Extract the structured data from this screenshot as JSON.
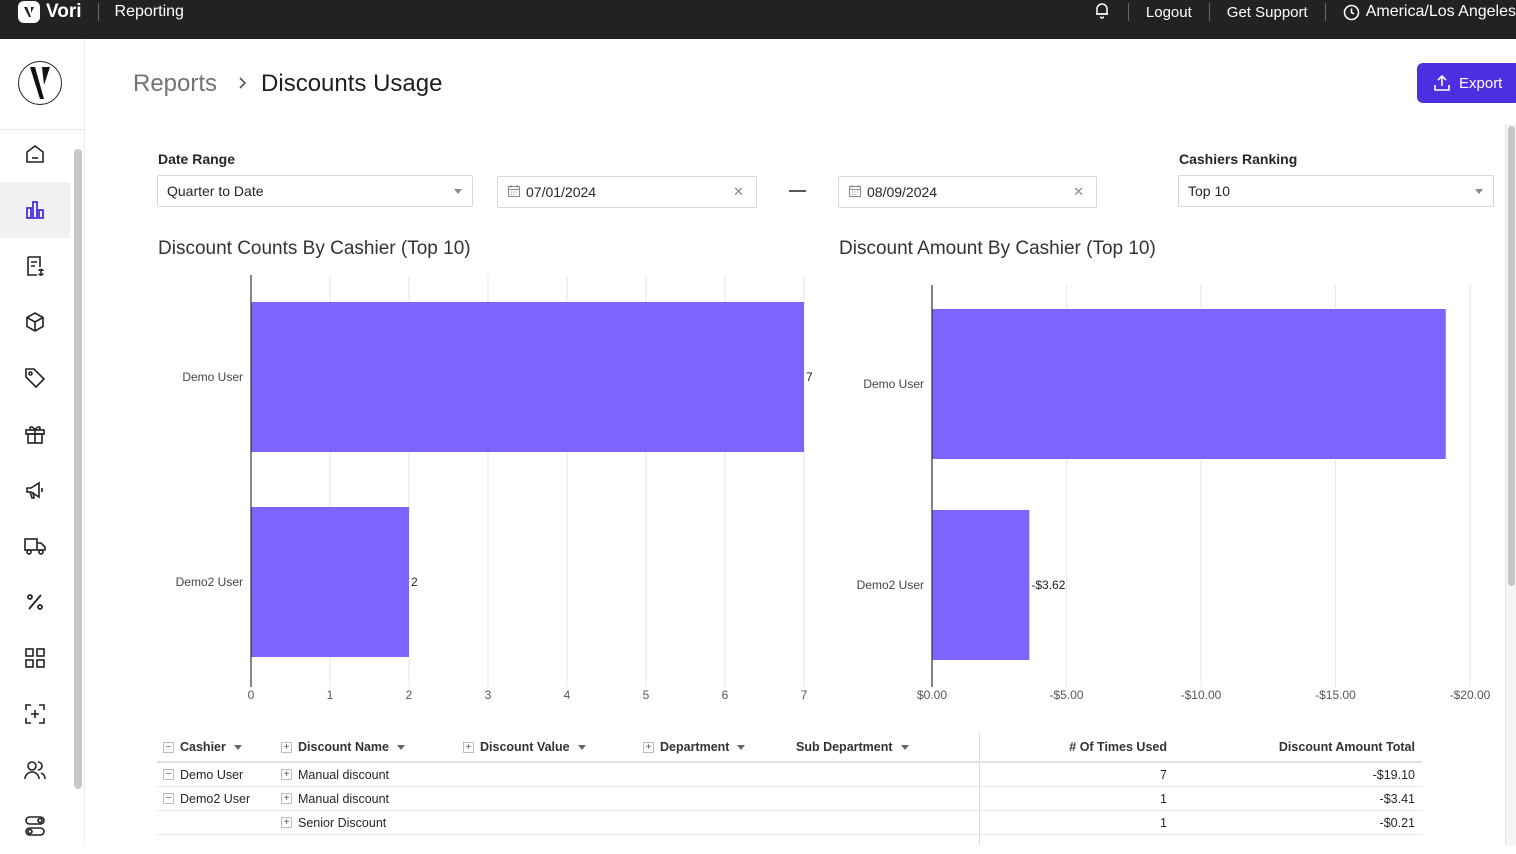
{
  "topbar": {
    "brand": "Vori",
    "section": "Reporting",
    "logout": "Logout",
    "support": "Get Support",
    "timezone": "America/Los Angeles"
  },
  "sidebar": {
    "items": [
      {
        "icon": "home-icon"
      },
      {
        "icon": "bar-chart-icon",
        "active": true
      },
      {
        "icon": "receipt-dollar-icon"
      },
      {
        "icon": "box-icon"
      },
      {
        "icon": "tag-icon"
      },
      {
        "icon": "gift-icon"
      },
      {
        "icon": "megaphone-icon"
      },
      {
        "icon": "truck-icon"
      },
      {
        "icon": "percent-icon"
      },
      {
        "icon": "grid-icon"
      },
      {
        "icon": "scan-add-icon"
      },
      {
        "icon": "users-icon"
      },
      {
        "icon": "toggles-icon"
      }
    ]
  },
  "breadcrumb": {
    "root": "Reports",
    "current": "Discounts Usage"
  },
  "export_label": "Export",
  "filters": {
    "date_range_label": "Date Range",
    "date_range_value": "Quarter to Date",
    "start_date": "07/01/2024",
    "end_date": "08/09/2024",
    "ranking_label": "Cashiers Ranking",
    "ranking_value": "Top 10"
  },
  "colors": {
    "accent": "#4d2ee0",
    "bar": "#7f63ff"
  },
  "chart_data": [
    {
      "type": "bar",
      "orientation": "horizontal",
      "title": "Discount Counts By Cashier (Top 10)",
      "categories": [
        "Demo User",
        "Demo2 User"
      ],
      "values": [
        7,
        2
      ],
      "value_labels": [
        "7",
        "2"
      ],
      "xlim": [
        0,
        7
      ],
      "ticks": [
        0,
        1,
        2,
        3,
        4,
        5,
        6,
        7
      ],
      "tick_labels": [
        "0",
        "1",
        "2",
        "3",
        "4",
        "5",
        "6",
        "7"
      ],
      "grid": true
    },
    {
      "type": "bar",
      "orientation": "horizontal",
      "title": "Discount Amount By Cashier (Top 10)",
      "categories": [
        "Demo User",
        "Demo2 User"
      ],
      "values": [
        -19.1,
        -3.62
      ],
      "value_labels": [
        "",
        "-$3.62"
      ],
      "xlim": [
        0,
        -20
      ],
      "ticks": [
        0,
        -5,
        -10,
        -15,
        -20
      ],
      "tick_labels": [
        "$0.00",
        "-$5.00",
        "-$10.00",
        "-$15.00",
        "-$20.00"
      ],
      "grid": true
    }
  ],
  "table": {
    "headers": {
      "cashier": "Cashier",
      "discount_name": "Discount Name",
      "discount_value": "Discount Value",
      "department": "Department",
      "sub_department": "Sub Department",
      "times_used": "# Of Times Used",
      "amount_total": "Discount Amount Total"
    },
    "rows": [
      {
        "cashier": "Demo User",
        "discount_name": "Manual discount",
        "times_used": "7",
        "amount_total": "-$19.10"
      },
      {
        "cashier": "Demo2 User",
        "discount_name": "Manual discount",
        "times_used": "1",
        "amount_total": "-$3.41"
      },
      {
        "cashier": "",
        "discount_name": "Senior Discount",
        "times_used": "1",
        "amount_total": "-$0.21"
      }
    ]
  }
}
